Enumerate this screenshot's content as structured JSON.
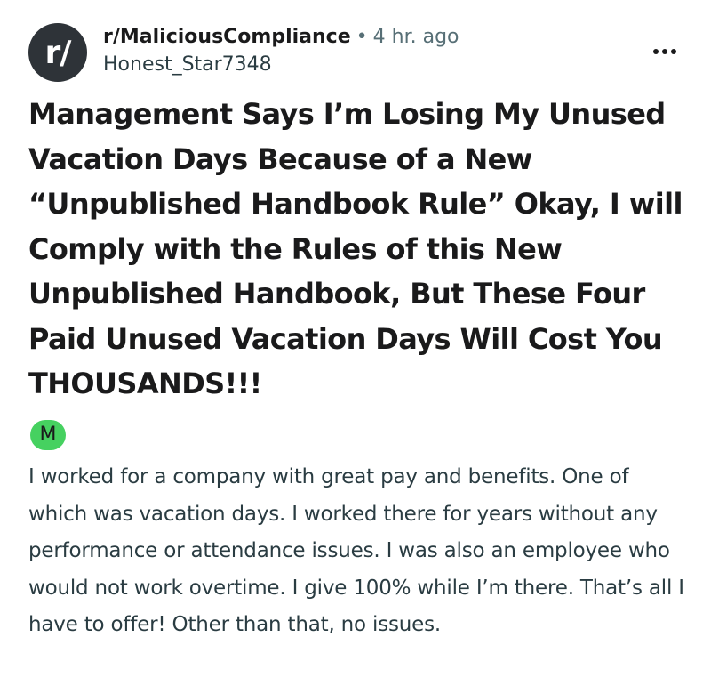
{
  "post": {
    "avatar_text": "r/",
    "subreddit": "r/MaliciousCompliance",
    "separator": "•",
    "time_ago": "4 hr. ago",
    "author": "Honest_Star7348",
    "more_icon": "more-horizontal-icon",
    "title": "Management Says I’m Losing My Unused Vacation Days Because of a New “Unpublished Handbook Rule” Okay, I will Comply with the Rules of this New Unpublished Handbook, But These Four Paid Unused Vacation Days Will Cost You THOUSANDS!!!",
    "flair": "M",
    "flair_color": "#46d160",
    "body": "I worked for a company with great pay and benefits. One of which was vacation days. I worked there for years without any performance or attendance issues. I was also an employee who would not work overtime. I give 100% while I’m there. That’s all I have to offer! Other than that, no issues."
  }
}
